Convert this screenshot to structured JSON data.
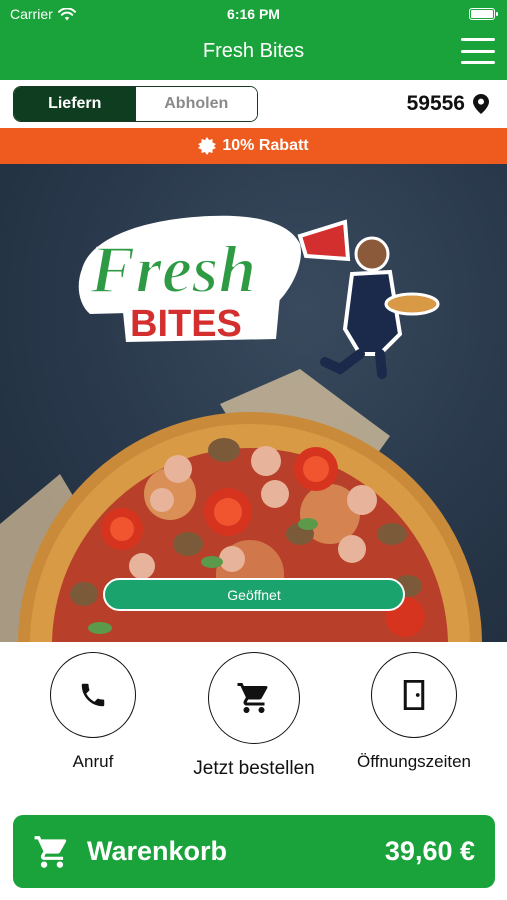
{
  "status_bar": {
    "carrier": "Carrier",
    "time": "6:16 PM"
  },
  "nav": {
    "title": "Fresh Bites"
  },
  "mode_toggle": {
    "delivery_label": "Liefern",
    "pickup_label": "Abholen",
    "selected": "Liefern"
  },
  "location": {
    "zip": "59556"
  },
  "discount": {
    "text": "10% Rabatt"
  },
  "hero": {
    "status_button": "Geöffnet"
  },
  "actions": [
    {
      "label": "Anruf",
      "icon": "phone-icon"
    },
    {
      "label": "Jetzt bestellen",
      "icon": "cart-icon"
    },
    {
      "label": "Öffnungszeiten",
      "icon": "door-icon"
    }
  ],
  "cart": {
    "label": "Warenkorb",
    "total": "39,60 €"
  },
  "colors": {
    "brand_green": "#1aa33a",
    "dark_green": "#0f3d1f",
    "discount_orange": "#ef5a1e",
    "open_button": "#1aa36d"
  }
}
